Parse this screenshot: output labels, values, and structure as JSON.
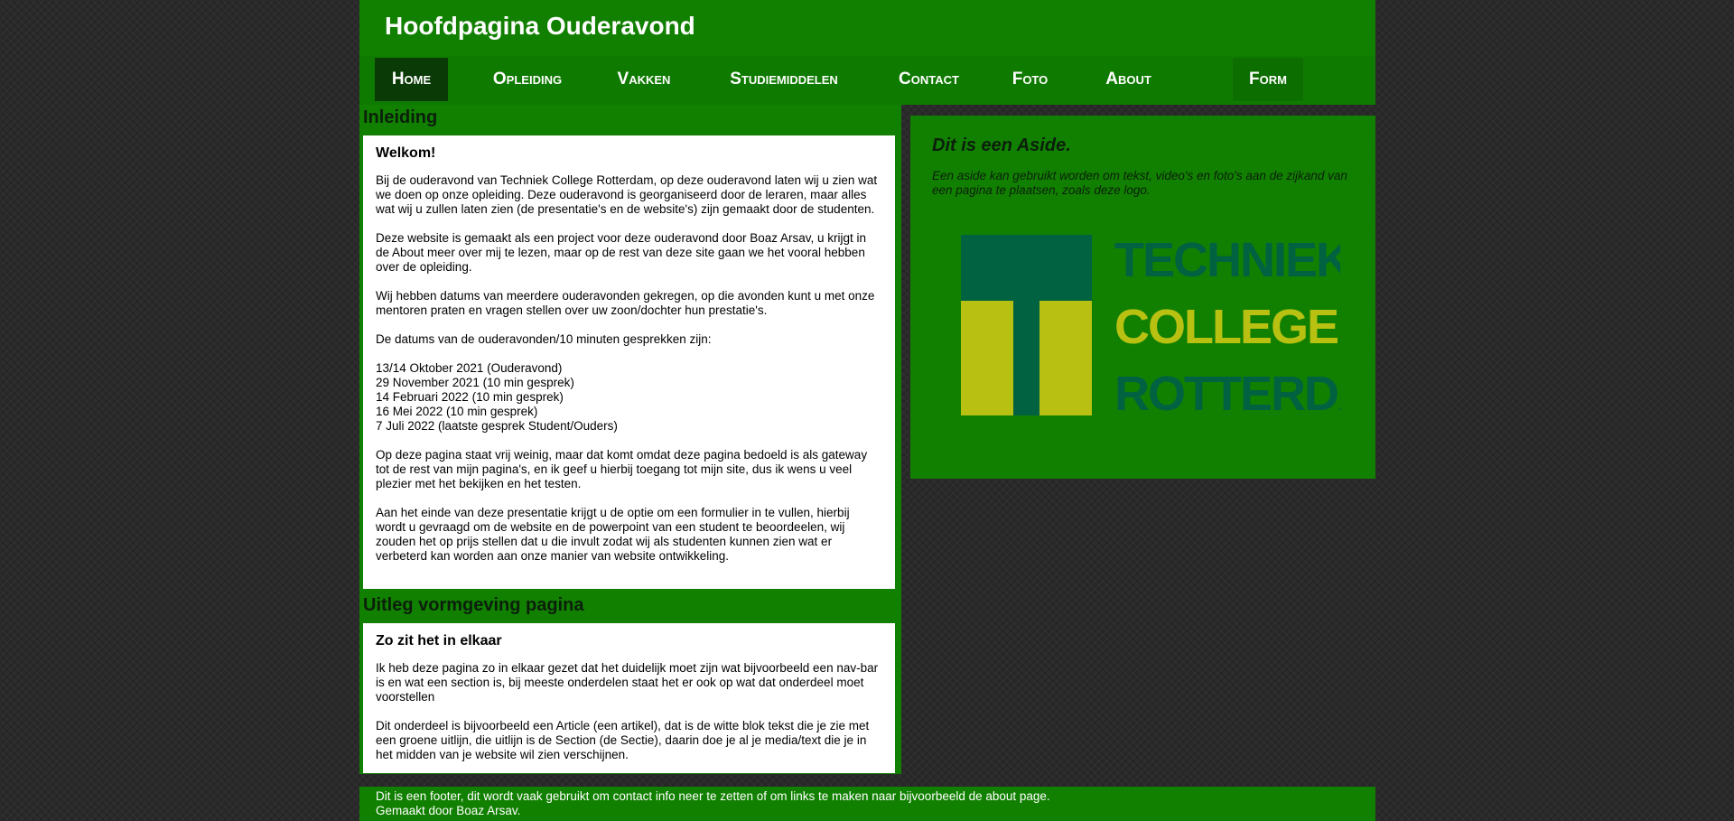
{
  "header": {
    "title": "Hoofdpagina Ouderavond"
  },
  "nav": {
    "items": [
      {
        "label": "Home"
      },
      {
        "label": "Opleiding"
      },
      {
        "label": "Vakken"
      },
      {
        "label": "Studiemiddelen"
      },
      {
        "label": "Contact"
      },
      {
        "label": "Foto"
      },
      {
        "label": "About"
      },
      {
        "label": "Form"
      }
    ],
    "active": "Home"
  },
  "sections": [
    {
      "title": "Inleiding",
      "article": {
        "heading": "Welkom!",
        "paragraphs": [
          "Bij de ouderavond van Techniek College Rotterdam, op deze ouderavond laten wij u zien wat we doen op onze opleiding. Deze ouderavond is georganiseerd door de leraren, maar alles wat wij u zullen laten zien (de presentatie's en de website's) zijn gemaakt door de studenten.",
          "Deze website is gemaakt als een project voor deze ouderavond door Boaz Arsav, u krijgt in de About meer over mij te lezen, maar op de rest van deze site gaan we het vooral hebben over de opleiding.",
          "Wij hebben datums van meerdere ouderavonden gekregen, op die avonden kunt u met onze mentoren praten en vragen stellen over uw zoon/dochter hun prestatie's.",
          "De datums van de ouderavonden/10 minuten gesprekken zijn:"
        ],
        "dates": [
          "13/14 Oktober 2021 (Ouderavond)",
          "29 November 2021 (10 min gesprek)",
          "14 Februari 2022 (10 min gesprek)",
          "16 Mei 2022 (10 min gesprek)",
          "7 Juli 2022 (laatste gesprek Student/Ouders)"
        ],
        "closing": [
          "Op deze pagina staat vrij weinig, maar dat komt omdat deze pagina bedoeld is als gateway tot de rest van mijn pagina's, en ik geef u hierbij toegang tot mijn site, dus ik wens u veel plezier met het bekijken en het testen.",
          "Aan het einde van deze presentatie krijgt u de optie om een formulier in te vullen, hierbij wordt u gevraagd om de website en de powerpoint van een student te beoordeelen, wij zouden het op prijs stellen dat u die invult zodat wij als studenten kunnen zien wat er verbeterd kan worden aan onze manier van website ontwikkeling."
        ]
      }
    },
    {
      "title": "Uitleg vormgeving pagina",
      "article": {
        "heading": "Zo zit het in elkaar",
        "paragraphs": [
          "Ik heb deze pagina zo in elkaar gezet dat het duidelijk moet zijn wat bijvoorbeeld een nav-bar is en wat een section is, bij meeste onderdelen staat het er ook op wat dat onderdeel moet voorstellen",
          "Dit onderdeel is bijvoorbeeld een Article (een artikel), dat is de witte blok tekst die je zie met een groene uitlijn, die uitlijn is de Section (de Sectie), daarin doe je al je media/text die je in het midden van je website wil zien verschijnen."
        ]
      }
    }
  ],
  "aside": {
    "heading": "Dit is een Aside.",
    "text": "Een aside kan gebruikt worden om tekst, video's en foto's aan de zijkand van een pagina te plaatsen, zoals deze logo.",
    "logo": {
      "lines": [
        "TECHNIEK",
        "COLLEGE",
        "ROTTERDAM"
      ],
      "colors": {
        "dark_green": "#006241",
        "yellow": "#b8c112"
      }
    }
  },
  "footer": {
    "line1": "Dit is een footer, dit wordt vaak gebruikt om contact info neer te zetten of om links te maken naar bijvoorbeeld de about page.",
    "line2": "Gemaakt door Boaz Arsav."
  },
  "colors": {
    "green": "#118000",
    "nav_active": "#0a3a06",
    "background": "#2a2a2a"
  }
}
